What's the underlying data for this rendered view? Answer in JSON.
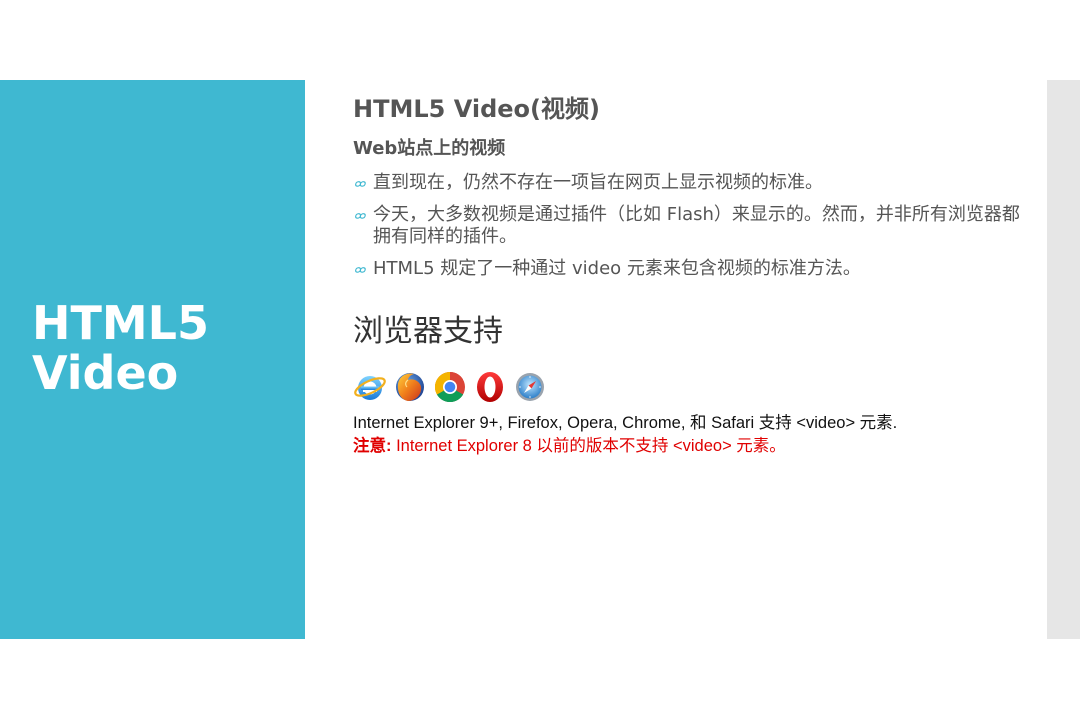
{
  "left_panel": {
    "title": "HTML5\nVideo",
    "background": "#3fb8d1"
  },
  "content": {
    "title": "HTML5 Video(视频)",
    "subtitle": "Web站点上的视频",
    "bullet_icon": "curl-bullet-icon",
    "bullet_symbol": "ᢁ",
    "bullets": [
      "直到现在，仍然不存在一项旨在网页上显示视频的标准。",
      "今天，大多数视频是通过插件（比如 Flash）来显示的。然而，并非所有浏览器都拥有同样的插件。",
      "HTML5 规定了一种通过 video 元素来包含视频的标准方法。"
    ]
  },
  "browser_support": {
    "heading": "浏览器支持",
    "icons": [
      "internet-explorer-icon",
      "firefox-icon",
      "chrome-icon",
      "opera-icon",
      "safari-icon"
    ],
    "support_text": "Internet Explorer 9+, Firefox, Opera, Chrome, 和 Safari 支持 <video> 元素.",
    "note_label": "注意:",
    "note_text": " Internet Explorer 8 以前的版本不支持 <video> 元素。",
    "note_color": "#e00000"
  }
}
